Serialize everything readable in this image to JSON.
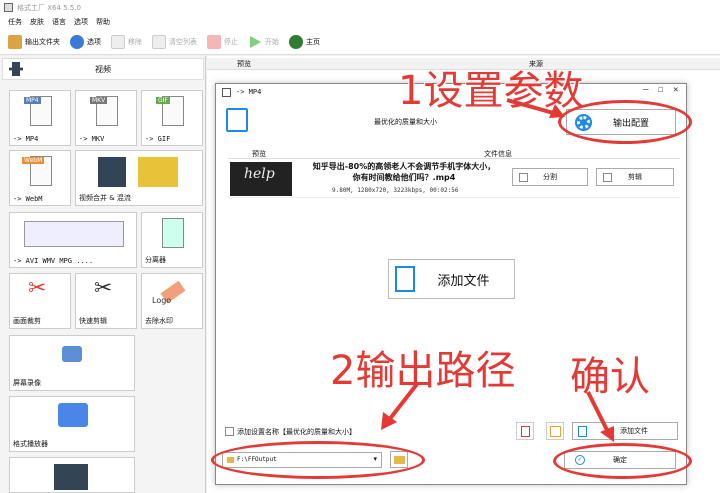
{
  "window": {
    "title": "格式工厂 X64 5.5.0"
  },
  "menu": [
    "任务",
    "皮肤",
    "语言",
    "选项",
    "帮助"
  ],
  "toolbar": {
    "output_folder": "输出文件夹",
    "options": "选项",
    "remove": "移除",
    "clear_list": "清空列表",
    "stop": "停止",
    "start": "开始",
    "home": "主页"
  },
  "left": {
    "header": "视频",
    "tiles": {
      "mp4": {
        "tag": "MP4",
        "label": "-> MP4"
      },
      "mkv": {
        "tag": "MKV",
        "label": "-> MKV"
      },
      "gif": {
        "tag": "GIF",
        "label": "-> GIF"
      },
      "webm": {
        "tag": "WebM",
        "label": "-> WebM"
      },
      "join": {
        "label": "视频合并 & 混流"
      },
      "avi": {
        "tags": [
          "AVI",
          "FLV",
          "MOV",
          "VOB"
        ],
        "label": "-> AVI WMV MPG ...."
      },
      "splitter": {
        "label": "分离器"
      },
      "crop": {
        "label": "画面裁剪"
      },
      "quick_clip": {
        "label": "快速剪辑"
      },
      "remove_watermark": {
        "label": "去除水印",
        "logo_text": "Logo"
      },
      "screen_record": {
        "label": "屏幕录像"
      },
      "player": {
        "label": "格式播放器"
      }
    }
  },
  "list_columns": {
    "preview": "预览",
    "source": "来源"
  },
  "dialog": {
    "title": "-> MP4",
    "quality": "最优化的质量和大小",
    "output_config": "输出配置",
    "col_preview": "预览",
    "col_fileinfo": "文件信息",
    "file": {
      "thumb_text": "help",
      "name_line1": "知乎导出-80%的高领老人不会调节手机字体大小，",
      "name_line2": "你有时间教给他们吗？.mp4",
      "meta": "9.80M, 1280x720, 3223kbps, 00:02:56"
    },
    "split": "分割",
    "clip": "剪辑",
    "add_file_big": "添加文件",
    "add_setting_label": "添加设置名称【最优化的质量和大小】",
    "add_file_small": "添加文件",
    "output_path": "F:\\FFOutput",
    "confirm": "确定"
  },
  "annotations": {
    "step1": "1设置参数",
    "step2": "2输出路径",
    "step3": "确认"
  },
  "colors": {
    "accent_red": "#e53935",
    "accent_blue": "#1e88e5"
  }
}
